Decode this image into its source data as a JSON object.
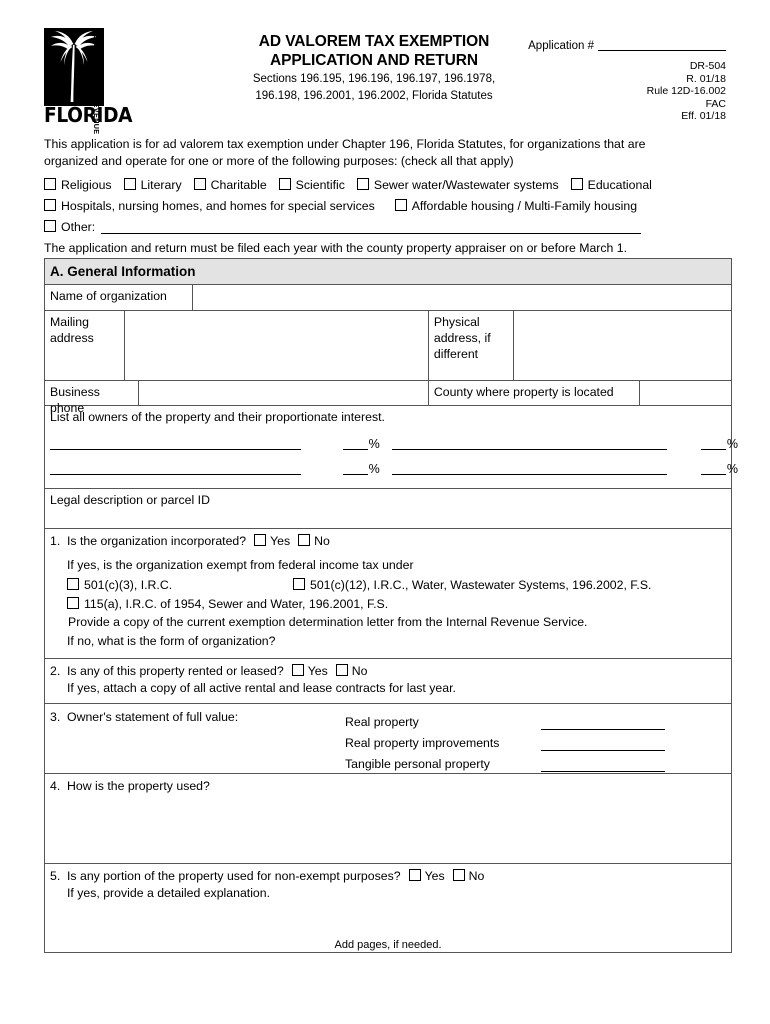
{
  "header": {
    "logo": {
      "agency_vertical": "Department of Revenue",
      "state_name": "FLORIDA",
      "icon": "palm-tree-icon"
    },
    "title_line1": "AD VALOREM TAX EXEMPTION",
    "title_line2": "APPLICATION AND RETURN",
    "statutes_line1": "Sections 196.195, 196.196, 196.197, 196.1978,",
    "statutes_line2": "196.198, 196.2001, 196.2002, Florida Statutes",
    "application_number_label": "Application #",
    "application_number_value": "",
    "form_id": "DR-504",
    "revision": "R. 01/18",
    "rule": "Rule 12D-16.002",
    "fac": "FAC",
    "effective": "Eff. 01/18"
  },
  "intro": {
    "line1": "This application is for ad valorem tax exemption under Chapter 196, Florida Statutes, for organizations that are",
    "line2": "organized and operate for one or more of the following purposes: (check all that apply)",
    "purposes_row1": [
      "Religious",
      "Literary",
      "Charitable",
      "Scientific",
      "Sewer water/Wastewater systems",
      "Educational"
    ],
    "purposes_row2": [
      "Hospitals, nursing homes, and homes for special services",
      "Affordable housing / Multi-Family housing"
    ],
    "other_label": "Other:",
    "other_value": "",
    "filing_note": "The application and return must be filed each year with the county property appraiser on or before March 1."
  },
  "section_a": {
    "heading": "A. General Information",
    "name_label": "Name of organization",
    "name_value": "",
    "mailing_label": "Mailing address",
    "mailing_value": "",
    "physical_label": "Physical address, if different",
    "physical_value": "",
    "phone_label": "Business phone",
    "phone_value": "",
    "county_label": "County where property is located",
    "county_value": "",
    "owners_prompt": "List all owners of the property and their proportionate interest.",
    "percent_symbol": "%",
    "owner_rows": [
      {
        "owner_a": "",
        "percent_a": "",
        "owner_b": "",
        "percent_b": ""
      },
      {
        "owner_a": "",
        "percent_a": "",
        "owner_b": "",
        "percent_b": ""
      }
    ],
    "legal_label": "Legal description or parcel ID",
    "legal_value": ""
  },
  "questions": {
    "q1": {
      "number": "1.",
      "text": "Is the organization incorporated?",
      "yes": "Yes",
      "no": "No",
      "sub_prompt": "If yes, is the organization exempt from federal income tax under",
      "opt1": "501(c)(3), I.R.C.",
      "opt2": "501(c)(12), I.R.C., Water, Wastewater Systems, 196.2002, F.S.",
      "opt3": "115(a), I.R.C. of 1954, Sewer and Water, 196.2001, F.S.",
      "note": "Provide a copy of the current exemption determination letter from the Internal Revenue Service.",
      "if_no": "If no, what is the form of organization?"
    },
    "q2": {
      "number": "2.",
      "text": "Is any of this property rented or leased?",
      "yes": "Yes",
      "no": "No",
      "sub": "If yes, attach a copy of all active rental and lease contracts for last year."
    },
    "q3": {
      "number": "3.",
      "text": "Owner's statement of full value:",
      "items": [
        {
          "label": "Real property",
          "value": ""
        },
        {
          "label": "Real property improvements",
          "value": ""
        },
        {
          "label": "Tangible personal property",
          "value": ""
        }
      ]
    },
    "q4": {
      "number": "4.",
      "text": "How is the property used?",
      "answer": ""
    },
    "q5": {
      "number": "5.",
      "text": "Is any portion of the property used for non-exempt purposes?",
      "yes": "Yes",
      "no": "No",
      "sub": "If yes, provide a detailed explanation.",
      "answer": ""
    }
  },
  "footer": {
    "note": "Add pages, if needed."
  },
  "colors": {
    "section_header_bg": "#e3e3e3",
    "border": "#555555",
    "text": "#000000"
  }
}
